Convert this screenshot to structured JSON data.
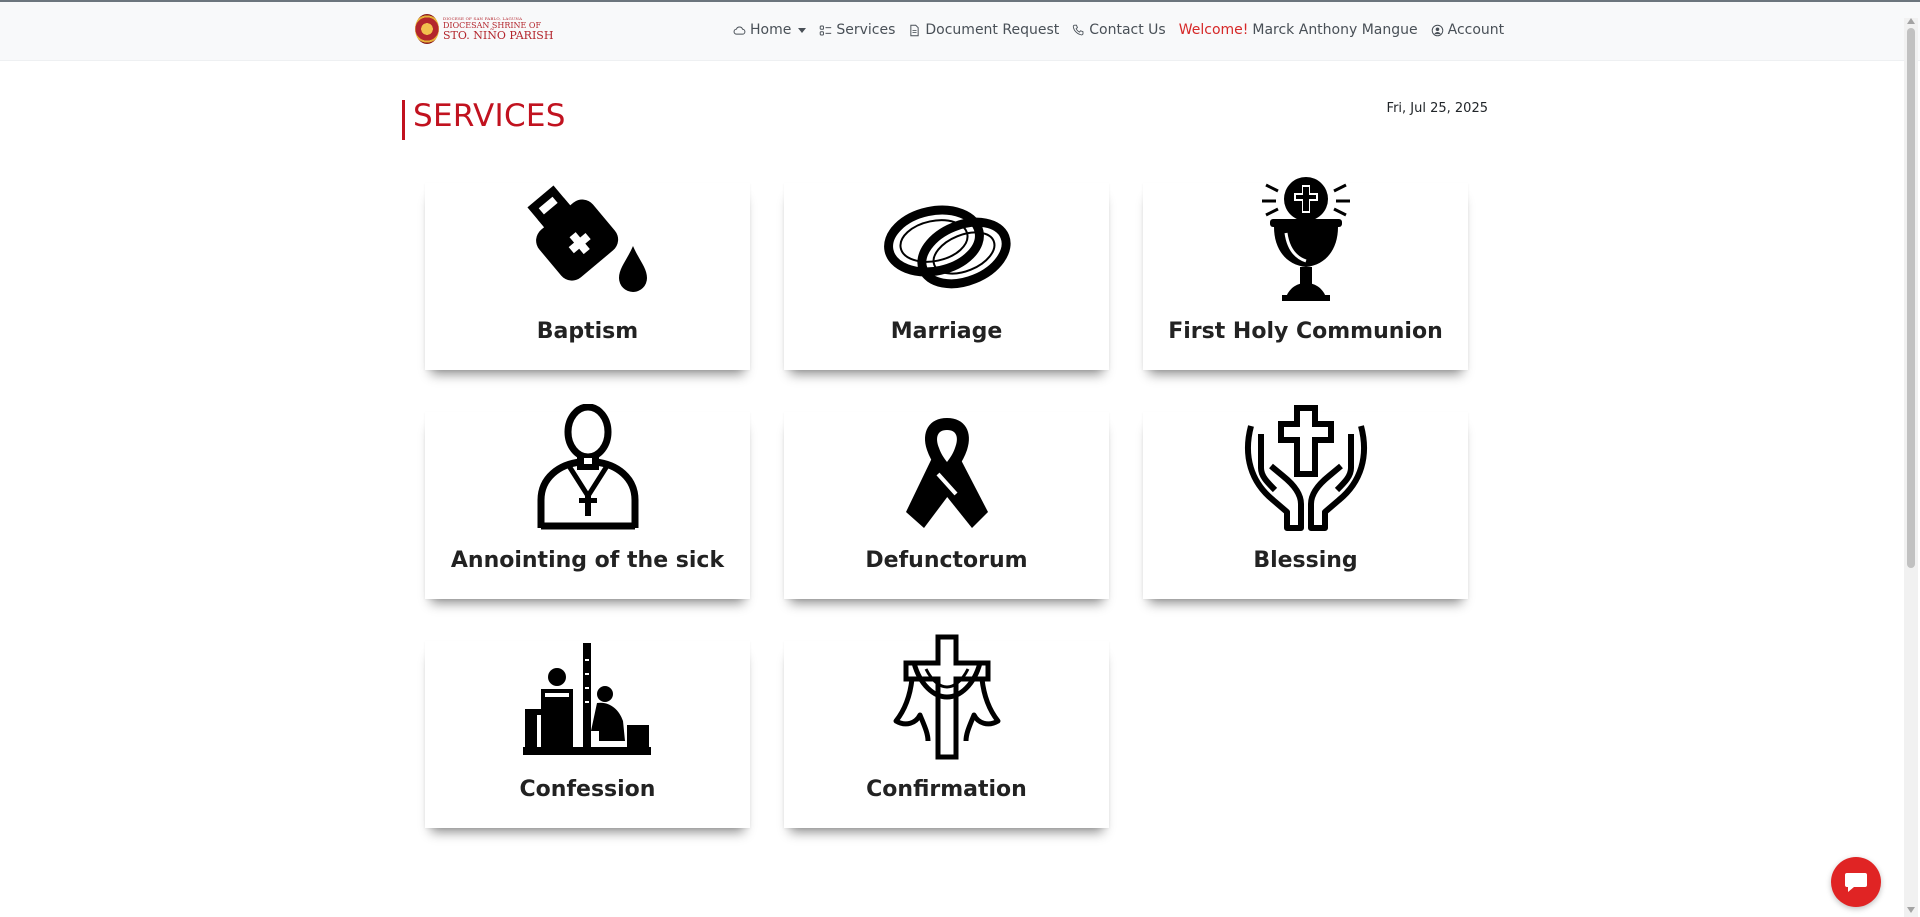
{
  "brand": {
    "line_small": "DIOCESE OF SAN PABLO, LAGUNA",
    "line1": "DIOCESAN SHRINE OF",
    "line2": "STO. NIÑO PARISH"
  },
  "nav": {
    "home": "Home",
    "services": "Services",
    "document_request": "Document Request",
    "contact_us": "Contact Us",
    "welcome_label": "Welcome!",
    "user_name": "Marck Anthony Mangue",
    "account": "Account"
  },
  "page": {
    "title": "SERVICES",
    "date": "Fri, Jul 25, 2025"
  },
  "services": [
    {
      "label": "Baptism",
      "icon": "baptism-oil-icon"
    },
    {
      "label": "Marriage",
      "icon": "wedding-rings-icon"
    },
    {
      "label": "First Holy Communion",
      "icon": "chalice-host-icon"
    },
    {
      "label": "Annointing of the sick",
      "icon": "priest-icon"
    },
    {
      "label": "Defunctorum",
      "icon": "ribbon-icon"
    },
    {
      "label": "Blessing",
      "icon": "hands-cross-icon"
    },
    {
      "label": "Confession",
      "icon": "confession-icon"
    },
    {
      "label": "Confirmation",
      "icon": "cross-drape-icon"
    }
  ],
  "colors": {
    "accent": "#c1121f",
    "navbar_bg": "#f8f9fa",
    "chat_button": "#e02424"
  }
}
